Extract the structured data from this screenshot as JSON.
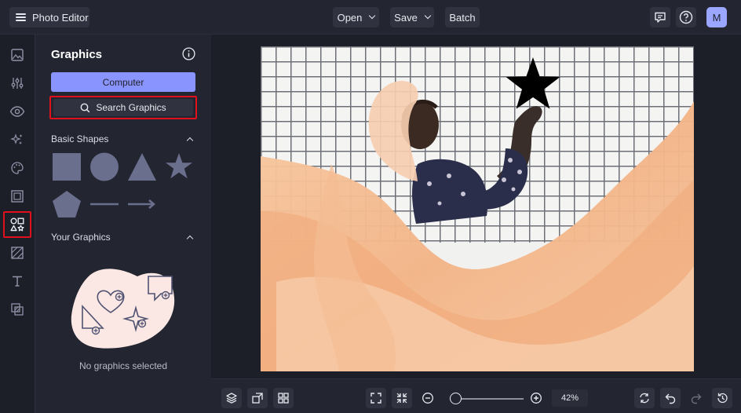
{
  "app": {
    "title": "Photo Editor"
  },
  "toolbar": {
    "open_label": "Open",
    "save_label": "Save",
    "batch_label": "Batch"
  },
  "user": {
    "avatar_initial": "M"
  },
  "rail": {
    "items": [
      "image-icon",
      "sliders-icon",
      "eye-icon",
      "sparkle-icon",
      "palette-icon",
      "frame-icon",
      "graphics-icon",
      "texture-icon",
      "text-icon",
      "overlay-icon"
    ],
    "active": "graphics-icon"
  },
  "panel": {
    "title": "Graphics",
    "computer_label": "Computer",
    "search_label": "Search Graphics",
    "basic_shapes_label": "Basic Shapes",
    "your_graphics_label": "Your Graphics",
    "empty_text": "No graphics selected"
  },
  "zoom": {
    "value_label": "42%",
    "fraction": 0.08
  },
  "colors": {
    "accent": "#8a94ff",
    "highlight": "#e0101c",
    "shape_fill": "#6b6f8e",
    "background": "#1d1f28",
    "panel": "#232530"
  }
}
